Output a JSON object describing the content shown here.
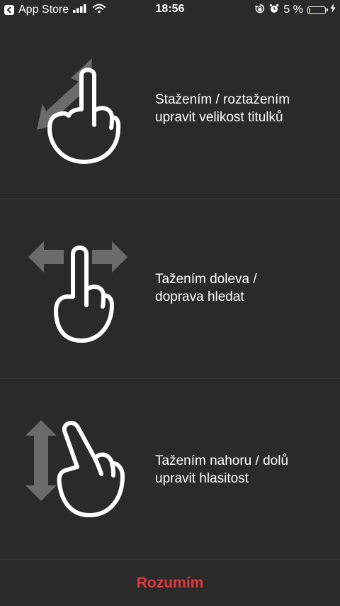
{
  "status_bar": {
    "back_app": "App Store",
    "time": "18:56",
    "battery_percent": "5 %",
    "battery_level": 0.05,
    "icons": [
      "back-chevron-icon",
      "signal-icon",
      "wifi-icon",
      "orientation-lock-icon",
      "alarm-icon",
      "battery-icon",
      "charging-bolt-icon"
    ]
  },
  "gestures": [
    {
      "icon": "pinch-zoom-hand-icon",
      "line1": "Stažením / roztažením",
      "line2": "upravit velikost titulků"
    },
    {
      "icon": "swipe-horizontal-hand-icon",
      "line1": "Tažením doleva /",
      "line2": "doprava hledat"
    },
    {
      "icon": "swipe-vertical-hand-icon",
      "line1": "Tažením nahoru / dolů",
      "line2": "upravit hlasitost"
    }
  ],
  "footer": {
    "confirm_label": "Rozumím"
  },
  "colors": {
    "background": "#2a2a2a",
    "arrow_gray": "#6b6b6b",
    "accent_red": "#e0393e",
    "battery_yellow": "#f5c518"
  }
}
